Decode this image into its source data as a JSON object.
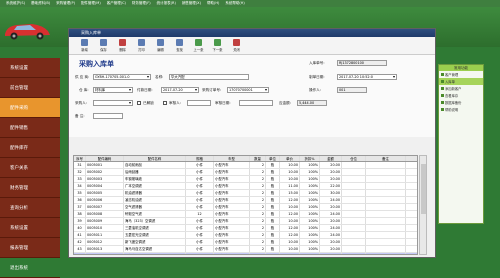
{
  "topmenu": [
    "系统维护(S)",
    "基础资料(B)",
    "采购管理(P)",
    "配件管理(M)",
    "客户管理(C)",
    "财务管理(F)",
    "统计报表(R)",
    "销售管理(X)",
    "帮助(H)",
    "系统帮助(H)"
  ],
  "header": {
    "system_name": "汽车美容管理系统",
    "brand_text": "爱车系统"
  },
  "sidebar": {
    "items": [
      {
        "label": "系统设置"
      },
      {
        "label": "前台管理"
      },
      {
        "label": "配件采购"
      },
      {
        "label": "配件销售"
      },
      {
        "label": "配件库存"
      },
      {
        "label": "客户关系"
      },
      {
        "label": "财务管理"
      },
      {
        "label": "查询分析"
      },
      {
        "label": "系统设置"
      },
      {
        "label": "报表管理"
      },
      {
        "label": "退出系统"
      }
    ]
  },
  "right_panel": {
    "title": "常用功能",
    "items": [
      {
        "label": "客户管理"
      },
      {
        "label": "入库单"
      },
      {
        "label": "添加新客户"
      },
      {
        "label": "查看库存"
      },
      {
        "label": "数据库备份"
      },
      {
        "label": "帮助说明"
      }
    ]
  },
  "window": {
    "title": "采购入库单",
    "toolbar": [
      {
        "label": "新增"
      },
      {
        "label": "保存"
      },
      {
        "label": "删除"
      },
      {
        "label": "打印"
      },
      {
        "label": "编辑"
      },
      {
        "label": "查找"
      },
      {
        "label": "上一张"
      },
      {
        "label": "下一张"
      },
      {
        "label": "关闭"
      }
    ],
    "form": {
      "title": "采购入库单",
      "entry_no_label": "入库单号:",
      "entry_no": "RJ1372800100",
      "supplier_no_label": "供 应 商:",
      "supplier_no": "GY8H-170705-001-0",
      "name_label": "名称:",
      "name_value": "华大汽配",
      "date_label": "制单日期:",
      "date_value": "2017-07-20 10:52:0",
      "warehouse_label": "仓 库:",
      "warehouse_value": "材料库",
      "pay_date_label": "付款日期:",
      "pay_date_value": "2017-07-20",
      "order_no_label": "采购订单号:",
      "order_no_value": "17070700001",
      "operator_label": "操作人:",
      "operator_value": "001",
      "buyer_label": "采购人:",
      "buyer_value": "",
      "paid_label": "已解锁",
      "audit_label": "审核人:",
      "audit_date_label": "审核日期:",
      "total_label": "应金额:",
      "total_value": "5,444.00",
      "remark_label": "备 注:",
      "remark_value": ""
    },
    "grid": {
      "columns": [
        "序号",
        "配件编码",
        "配件名称",
        "规格",
        "车型",
        "数量",
        "单位",
        "单价",
        "折扣%",
        "金额",
        "仓位",
        "备注"
      ],
      "rows": [
        [
          "31",
          "0005001",
          "自动前雨刮",
          "小件",
          "小型汽车",
          "2",
          "瓶",
          "10.00",
          "100%",
          "20.00",
          "",
          ""
        ],
        [
          "32",
          "0005002",
          "后雨刮器",
          "小件",
          "小型汽车",
          "2",
          "瓶",
          "10.00",
          "100%",
          "20.00",
          "",
          ""
        ],
        [
          "33",
          "0005003",
          "车窗玻璃液",
          "小件",
          "小型汽车",
          "2",
          "瓶",
          "10.00",
          "100%",
          "20.00",
          "",
          ""
        ],
        [
          "34",
          "0005004",
          "广本空调滤",
          "小件",
          "小型汽车",
          "2",
          "瓶",
          "11.00",
          "100%",
          "22.00",
          "",
          ""
        ],
        [
          "35",
          "0005005",
          "机油滤清器",
          "小件",
          "小型汽车",
          "2",
          "瓶",
          "15.00",
          "100%",
          "30.00",
          "",
          ""
        ],
        [
          "36",
          "0005006",
          "凌志机油滤",
          "小件",
          "小型汽车",
          "2",
          "瓶",
          "12.00",
          "100%",
          "24.00",
          "",
          ""
        ],
        [
          "37",
          "0005007",
          "空气滤清器",
          "小件",
          "小型汽车",
          "2",
          "瓶",
          "10.00",
          "100%",
          "20.00",
          "",
          ""
        ],
        [
          "38",
          "0005008",
          "轩毅空气滤",
          "12",
          "小型汽车",
          "2",
          "瓶",
          "12.00",
          "100%",
          "24.00",
          "",
          ""
        ],
        [
          "39",
          "0005009",
          "海马（323）空调滤",
          "小件",
          "小型汽车",
          "2",
          "瓶",
          "10.00",
          "100%",
          "20.00",
          "",
          ""
        ],
        [
          "40",
          "0005010",
          "三菱油机空调滤",
          "小件",
          "小型汽车",
          "2",
          "瓶",
          "12.00",
          "100%",
          "24.00",
          "",
          ""
        ],
        [
          "41",
          "0005011",
          "五菱宏光空调滤",
          "小件",
          "小型汽车",
          "2",
          "瓶",
          "12.00",
          "100%",
          "24.00",
          "",
          ""
        ],
        [
          "42",
          "0005012",
          "新飞度空调滤",
          "小件",
          "小型汽车",
          "2",
          "瓶",
          "10.00",
          "100%",
          "20.00",
          "",
          ""
        ],
        [
          "43",
          "0005013",
          "海马马自达空调滤",
          "小件",
          "小型汽车",
          "2",
          "瓶",
          "10.00",
          "100%",
          "20.00",
          "",
          ""
        ],
        [
          "44",
          "0008001",
          "昆虹漆",
          "小件",
          "小型汽车",
          "2",
          "瓶",
          "40.00",
          "100%",
          "80.00",
          "",
          ""
        ]
      ]
    }
  },
  "colors": {
    "bg": "#2f7a34",
    "sidebar": "#7a2a18",
    "sidebar_active": "#e8952d",
    "title": "#1f3a6a",
    "selected_row": "#c4c8f8"
  }
}
